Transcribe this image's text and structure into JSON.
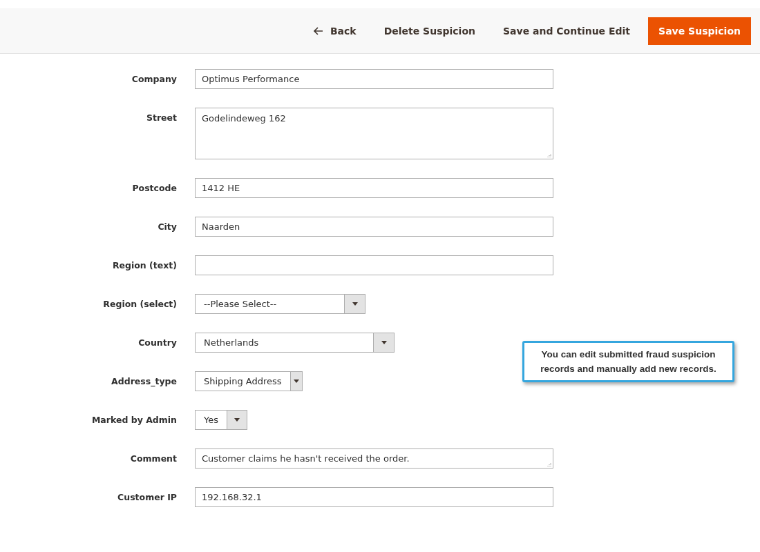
{
  "toolbar": {
    "buttons": [
      {
        "label": "Back",
        "kind": "back"
      },
      {
        "label": "Delete Suspicion",
        "kind": "plain"
      },
      {
        "label": "Save and Continue Edit",
        "kind": "plain"
      },
      {
        "label": "Save Suspicion",
        "kind": "primary"
      }
    ]
  },
  "form": {
    "fields": [
      {
        "label": "Company",
        "kind": "text",
        "value": "Optimus Performance"
      },
      {
        "label": "Street",
        "kind": "textarea",
        "value": "Godelindeweg 162"
      },
      {
        "label": "Postcode",
        "kind": "text",
        "value": "1412 HE"
      },
      {
        "label": "City",
        "kind": "text",
        "value": "Naarden"
      },
      {
        "label": "Region (text)",
        "kind": "text"
      },
      {
        "label": "Region (select)",
        "kind": "select",
        "value": "--Please Select--"
      },
      {
        "label": "Country",
        "kind": "select",
        "value": "Netherlands"
      },
      {
        "label": "Address_type",
        "kind": "select",
        "value": "Shipping Address"
      },
      {
        "label": "Marked by Admin",
        "kind": "select",
        "value": "Yes"
      },
      {
        "label": "Comment",
        "kind": "comment",
        "value": "Customer claims he hasn't received the order."
      },
      {
        "label": "Customer IP",
        "kind": "text",
        "value": "192.168.32.1"
      }
    ]
  },
  "callout": {
    "text": "You can edit submitted fraud suspicion records and manually add new records."
  }
}
